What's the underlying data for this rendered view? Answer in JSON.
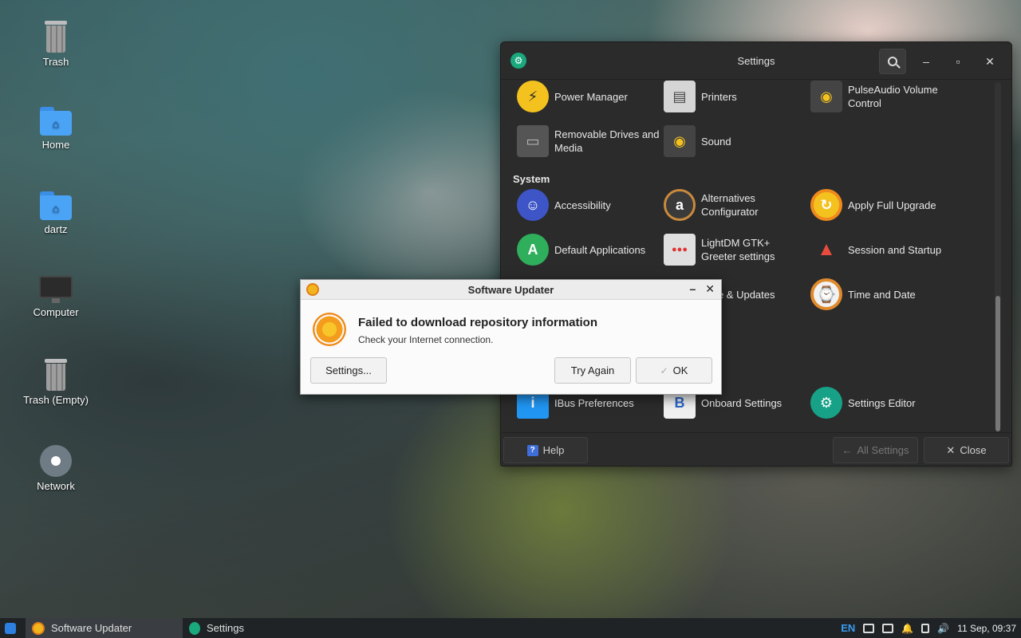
{
  "desktop": {
    "icons": [
      {
        "label": "Trash",
        "icon": "trash-icon"
      },
      {
        "label": "Home",
        "icon": "home-folder-icon"
      },
      {
        "label": "dartz",
        "icon": "folder-icon"
      },
      {
        "label": "Computer",
        "icon": "computer-icon"
      },
      {
        "label": "Trash (Empty)",
        "icon": "trash-icon"
      },
      {
        "label": "Network",
        "icon": "network-icon"
      }
    ]
  },
  "settings": {
    "title": "Settings",
    "items_top": [
      {
        "label": "Power Manager",
        "icon": "power-icon"
      },
      {
        "label": "Printers",
        "icon": "printer-icon"
      },
      {
        "label": "PulseAudio Volume Control",
        "icon": "speaker-icon"
      },
      {
        "label": "Removable Drives and Media",
        "icon": "drive-icon"
      },
      {
        "label": "Sound",
        "icon": "speaker-icon"
      }
    ],
    "section_system": "System",
    "items_system": [
      {
        "label": "Accessibility",
        "icon": "accessibility-icon"
      },
      {
        "label": "Alternatives Configurator",
        "icon": "alternatives-icon"
      },
      {
        "label": "Apply Full Upgrade",
        "icon": "upgrade-icon"
      },
      {
        "label": "Default Applications",
        "icon": "default-apps-icon"
      },
      {
        "label": "LightDM GTK+ Greeter settings",
        "icon": "lightdm-icon"
      },
      {
        "label": "Session and Startup",
        "icon": "rocket-icon"
      },
      {
        "label": "ware & Updates",
        "icon": "software-updates-icon"
      },
      {
        "label": "Time and Date",
        "icon": "clock-icon"
      },
      {
        "label": "IBus Preferences",
        "icon": "ibus-icon"
      },
      {
        "label": "Onboard Settings",
        "icon": "onboard-icon"
      },
      {
        "label": "Settings Editor",
        "icon": "settings-editor-icon"
      }
    ],
    "footer": {
      "help": "Help",
      "all_settings": "All Settings",
      "close": "Close"
    }
  },
  "dialog": {
    "title": "Software Updater",
    "heading": "Failed to download repository information",
    "message": "Check your Internet connection.",
    "btn_settings": "Settings...",
    "btn_try_again": "Try Again",
    "btn_ok": "OK"
  },
  "taskbar": {
    "tasks": [
      "Software Updater",
      "Settings"
    ],
    "lang": "EN",
    "clock": "11 Sep, 09:37"
  }
}
